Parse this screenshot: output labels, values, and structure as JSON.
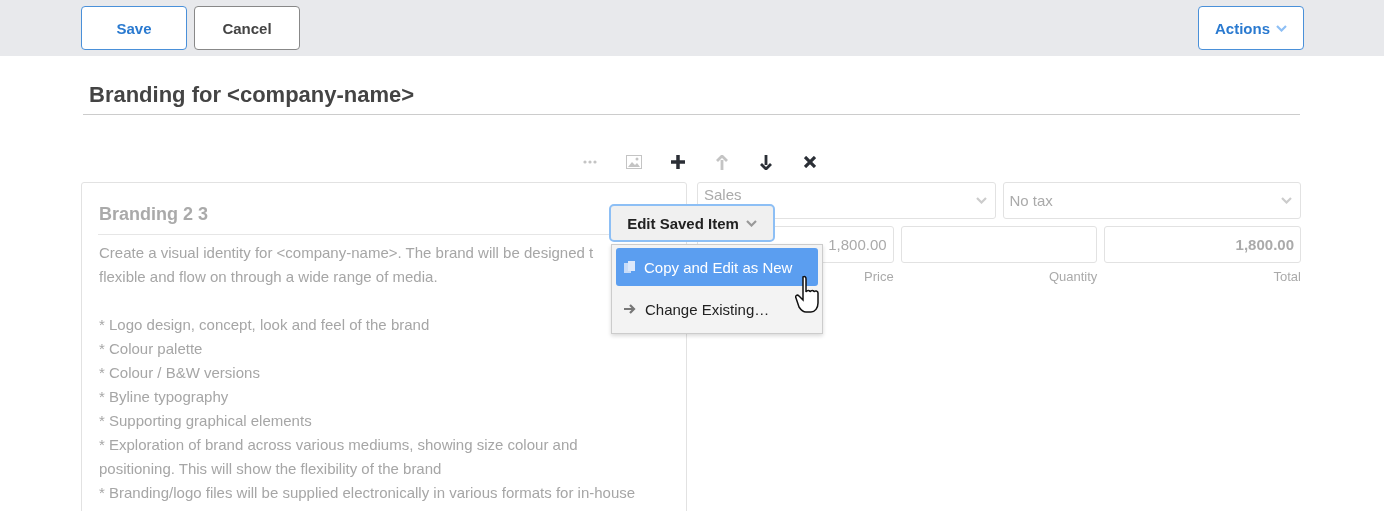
{
  "top_bar": {
    "buttons": [
      {
        "label": "Save",
        "kind": "primary"
      },
      {
        "label": "Cancel",
        "kind": "default"
      }
    ],
    "actions": {
      "label": "Actions"
    }
  },
  "page_title": "Branding for <company-name>",
  "toolbar": [
    {
      "kind": "more",
      "disabled": true
    },
    {
      "kind": "image",
      "disabled": true
    },
    {
      "kind": "add",
      "disabled": false
    },
    {
      "kind": "up",
      "disabled": true
    },
    {
      "kind": "down",
      "disabled": false
    },
    {
      "kind": "delete",
      "disabled": false
    }
  ],
  "item": {
    "title": "Branding 2 3",
    "description": [
      "Create a visual identity for <company-name>. The brand will be designed t",
      "flexible and flow on through a wide range of media."
    ],
    "bullets": [
      "* Logo design, concept, look and feel of the brand",
      "* Colour palette",
      "* Colour / B&W versions",
      "* Byline typography",
      "* Supporting graphical elements",
      "* Exploration of brand across various mediums, showing size colour and",
      "positioning. This will show the flexibility of the brand",
      "* Branding/logo files will be supplied electronically in various formats for in-house"
    ]
  },
  "account": {
    "value": "Sales"
  },
  "tax": {
    "value": "No tax"
  },
  "amounts": [
    {
      "label": "Price",
      "value": "1,800.00",
      "kind": "price"
    },
    {
      "label": "Quantity",
      "kind": "quantity"
    },
    {
      "label": "Total",
      "value": "1,800.00",
      "kind": "total"
    }
  ],
  "popup": {
    "button": "Edit Saved Item",
    "menu": [
      {
        "label": "Copy and Edit as New",
        "kind": "copy",
        "selected": true
      },
      {
        "label": "Change Existing…",
        "kind": "arrow",
        "selected": false
      }
    ]
  }
}
